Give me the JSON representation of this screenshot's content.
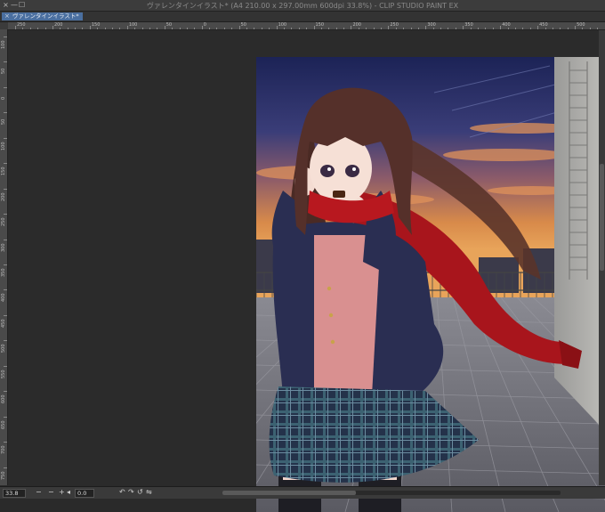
{
  "window": {
    "title": "ヴァレンタインイラスト* (A4 210.00 x 297.00mm 600dpi 33.8%) - CLIP STUDIO PAINT EX",
    "minimize_glyph": "—",
    "maximize_glyph": "☐"
  },
  "tabs": [
    {
      "label": "ヴァレンタインイラスト*",
      "close_glyph": "×",
      "active": true
    }
  ],
  "ruler": {
    "horizontal_labels": [
      "250",
      "200",
      "150",
      "100",
      "50",
      "0",
      "50",
      "100",
      "150",
      "200",
      "250",
      "300",
      "350",
      "400",
      "450",
      "500"
    ],
    "vertical_labels": [
      "100",
      "50",
      "0",
      "50",
      "100",
      "150",
      "200",
      "250",
      "300",
      "350",
      "400",
      "450",
      "500",
      "550",
      "600",
      "650",
      "700",
      "750"
    ]
  },
  "status": {
    "zoom": "33.8",
    "zoom_out_glyph": "−",
    "zoom_in_glyph": "+",
    "rotation": "0.0",
    "rotate_left_glyph": "↶",
    "rotate_right_glyph": "↷",
    "reset_glyph": "↺",
    "flip_glyph": "⇋"
  },
  "colors": {
    "accent": "#4a6fa0",
    "workspace": "#2b2b2b",
    "scarf": "#a8151c",
    "blazer": "#2a2e52",
    "sky_top": "#1c2356",
    "sky_bottom": "#d88a4a"
  }
}
